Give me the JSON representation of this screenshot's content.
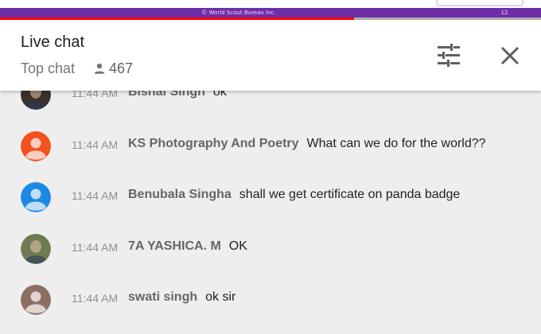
{
  "video": {
    "caption": "© World Scout Bureau Inc.",
    "slide_number": "12",
    "progress_fraction": 0.655,
    "brand_purple": "#6f2da8",
    "progress_color": "#ff0000"
  },
  "header": {
    "title": "Live chat",
    "mode": "Top chat",
    "viewer_icon": "person-icon",
    "viewer_count": "467",
    "filter_icon": "tune-icon",
    "close_icon": "close-icon"
  },
  "messages": [
    {
      "avatar": "photo-avatar",
      "avatar_color": "#3b2f2a",
      "time": "11:44 AM",
      "author": "Bishal Singh",
      "text": "ok"
    },
    {
      "avatar": "default-avatar",
      "avatar_color": "#f4511e",
      "time": "11:44 AM",
      "author": "KS Photography And Poetry",
      "text": "What can we do for the world??"
    },
    {
      "avatar": "default-avatar",
      "avatar_color": "#1e88e5",
      "time": "11:44 AM",
      "author": "Benubala Singha",
      "text": "shall we get certificate on panda badge"
    },
    {
      "avatar": "photo-avatar",
      "avatar_color": "#6d7a52",
      "time": "11:44 AM",
      "author": "7A YASHICA. M",
      "text": "OK"
    },
    {
      "avatar": "default-avatar",
      "avatar_color": "#8d6e63",
      "time": "11:44 AM",
      "author": "swati singh",
      "text": "ok sir"
    }
  ]
}
